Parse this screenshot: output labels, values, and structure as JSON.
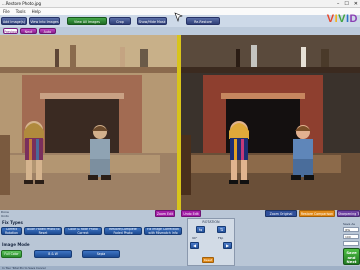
{
  "window": {
    "title": "...Restore Photo.jpg",
    "min": "–",
    "max": "☐",
    "close": "✕"
  },
  "menu": [
    "File",
    "Tools",
    "Help"
  ],
  "toolbar": {
    "buttons": [
      "Add Image(s)",
      "View Into Images",
      "View All Images",
      "Crop",
      "Show/Hide Mask",
      "Re-Restore"
    ],
    "logo": {
      "letters": [
        "V",
        "I",
        "V",
        "I",
        "D"
      ],
      "colors": [
        "#e8462a",
        "#f2b21c",
        "#3fa33f",
        "#2b73c7",
        "#8a3fb3"
      ]
    }
  },
  "actions": {
    "left": "Previous",
    "mid": "Next",
    "extra": "Auto"
  },
  "compare": {
    "before_label": "Zoom Edit",
    "after_label": "Undo Edit",
    "original": "Zoom Original",
    "restore": "Restore Comparison",
    "sharpen": "Sharpening Tools"
  },
  "panels": {
    "fix_title": "Fix Types",
    "fix_buttons": [
      "Correct Rotation",
      "Touch Faded Photo to Reset",
      "Color & Fade Photo Correct",
      "Restore/Complete Faded Photo",
      "Fix Image Correction with Mismatch Info"
    ],
    "mode_title": "Image Mode",
    "mode_buttons": [
      "Full Color",
      "B & W",
      "Sepia"
    ],
    "left_hint": [
      "Done",
      "Undo"
    ]
  },
  "rotation": {
    "title": "ROTATION",
    "flip_h": "⇆",
    "flip_v": "⇅",
    "left": "◀",
    "right": "▶",
    "rotate_label": "90°",
    "mirror_label": "Flip",
    "reset": "Reset"
  },
  "fields": {
    "save_as_label": "Save As",
    "format_label": "JPG",
    "quality_value": "100",
    "filename": ""
  },
  "save": {
    "line1": "Save",
    "line2": "and",
    "line3": "Next"
  },
  "statusbar": "In Tour  Total Pix to Save  Cancel"
}
